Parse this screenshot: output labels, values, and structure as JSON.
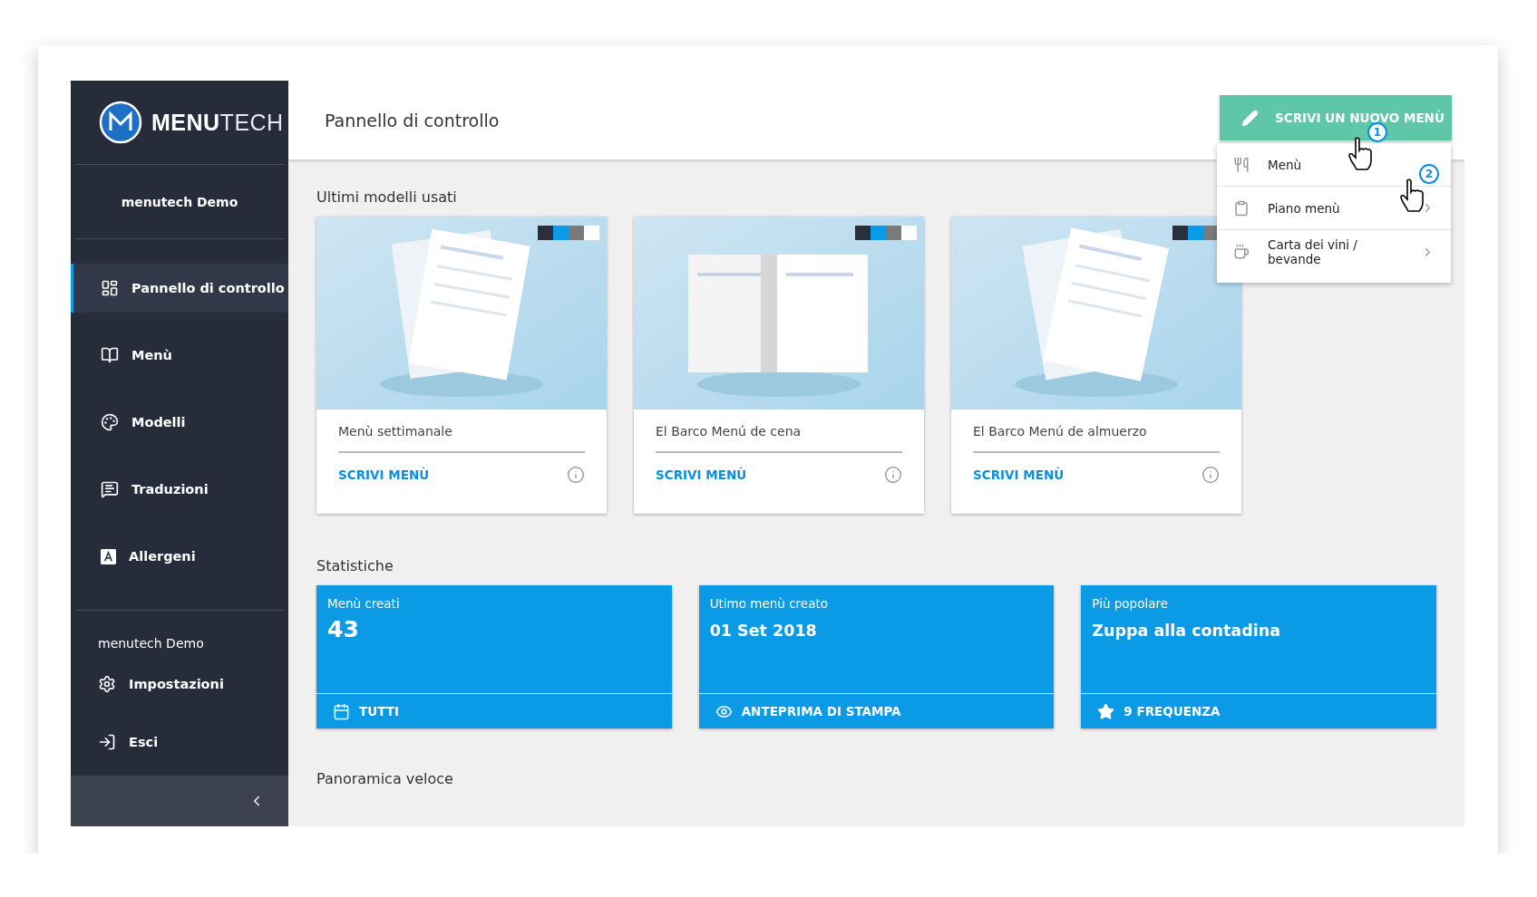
{
  "sidebar": {
    "logo": {
      "bold": "MENU",
      "light": "TECH"
    },
    "account": "menutech Demo",
    "items": [
      {
        "label": "Pannello di controllo",
        "selected": true
      },
      {
        "label": "Menù",
        "selected": false
      },
      {
        "label": "Modelli",
        "selected": false
      },
      {
        "label": "Traduzioni",
        "selected": false
      },
      {
        "label": "Allergeni",
        "selected": false
      }
    ],
    "section": "menutech Demo",
    "bottom_items": [
      {
        "label": "Impostazioni"
      },
      {
        "label": "Esci"
      }
    ]
  },
  "header": {
    "title": "Pannello di controllo",
    "button": "SCRIVI UN NUOVO MENÙ"
  },
  "dropdown": {
    "items": [
      {
        "label": "Menù",
        "submenu": false
      },
      {
        "label": "Piano menù",
        "submenu": true
      },
      {
        "label": "Carta dei vini / bevande",
        "submenu": true
      }
    ]
  },
  "cursors": [
    {
      "badge": "1"
    },
    {
      "badge": "2"
    }
  ],
  "recent": {
    "title": "Ultimi modelli usati",
    "cards": [
      {
        "kind": "picture",
        "name": "Menù settimanale",
        "link": "SCRIVI MENÙ",
        "swatches": [
          {
            "color": "#2b2e3b"
          },
          {
            "color": "#0b9be6"
          },
          {
            "color": "#7a7a7a"
          },
          {
            "color": "#ffffff"
          }
        ]
      },
      {
        "kind": "picture",
        "name": "El Barco Menú de cena",
        "link": "SCRIVI MENÙ",
        "swatches": [
          {
            "color": "#2b2e3b"
          },
          {
            "color": "#0b9be6"
          },
          {
            "color": "#7a7a7a"
          },
          {
            "color": "#ffffff"
          }
        ]
      },
      {
        "kind": "picture",
        "name": "El Barco Menú de almuerzo",
        "link": "SCRIVI MENÙ",
        "swatches": [
          {
            "color": "#2b2e3b"
          },
          {
            "color": "#0b9be6"
          },
          {
            "color": "#7a7a7a"
          }
        ]
      }
    ]
  },
  "stats": {
    "title": "Statistiche",
    "tiles": [
      {
        "label": "Menù creati",
        "value": "43",
        "action": "TUTTI"
      },
      {
        "label": "Utimo menù creato",
        "value": "01 Set 2018",
        "action": "ANTEPRIMA DI STAMPA"
      },
      {
        "label": "Più popolare",
        "value": "Zuppa alla contadina",
        "action": "9 FREQUENZA"
      }
    ]
  },
  "overview": {
    "title": "Panoramica veloce"
  }
}
